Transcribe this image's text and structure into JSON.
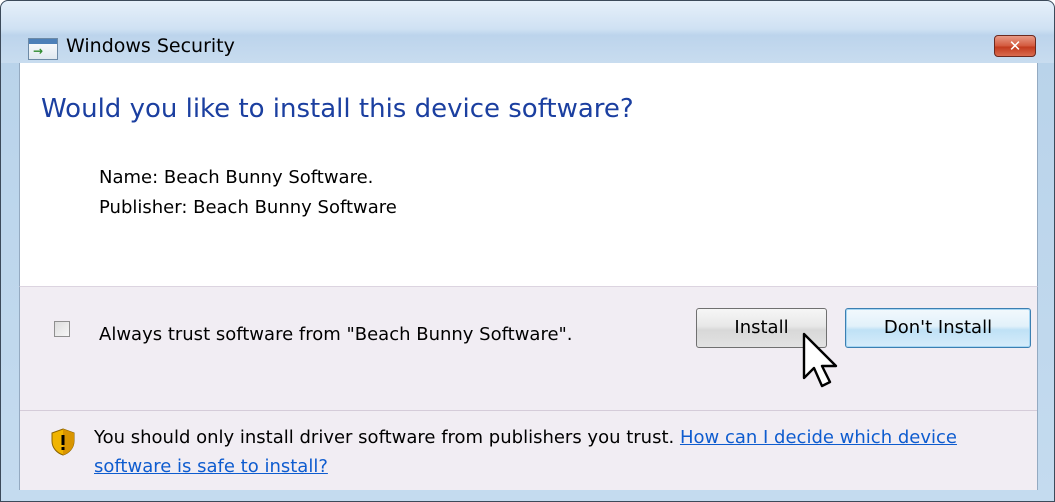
{
  "window": {
    "title": "Windows Security",
    "close_label": "✕"
  },
  "dialog": {
    "question": "Would you like to install this device software?",
    "name_line": "Name: Beach Bunny Software.",
    "publisher_line": "Publisher: Beach Bunny Software"
  },
  "footer": {
    "trust_label": "Always trust software from \"Beach Bunny Software\".",
    "trust_checked": false,
    "install_label": "Install",
    "dont_install_label": "Don't Install",
    "warning_text": "You should only install driver software from publishers you trust. ",
    "help_link": "How can I decide which device software is safe to install?"
  },
  "icons": {
    "title_icon": "device-install-icon",
    "warning_icon": "shield-warning-icon",
    "cursor": "mouse-pointer-icon"
  },
  "colors": {
    "question": "#1b3fa0",
    "link": "#0e5ccf",
    "close_button": "#c23a1d",
    "footer_bg": "#f1edf3"
  }
}
